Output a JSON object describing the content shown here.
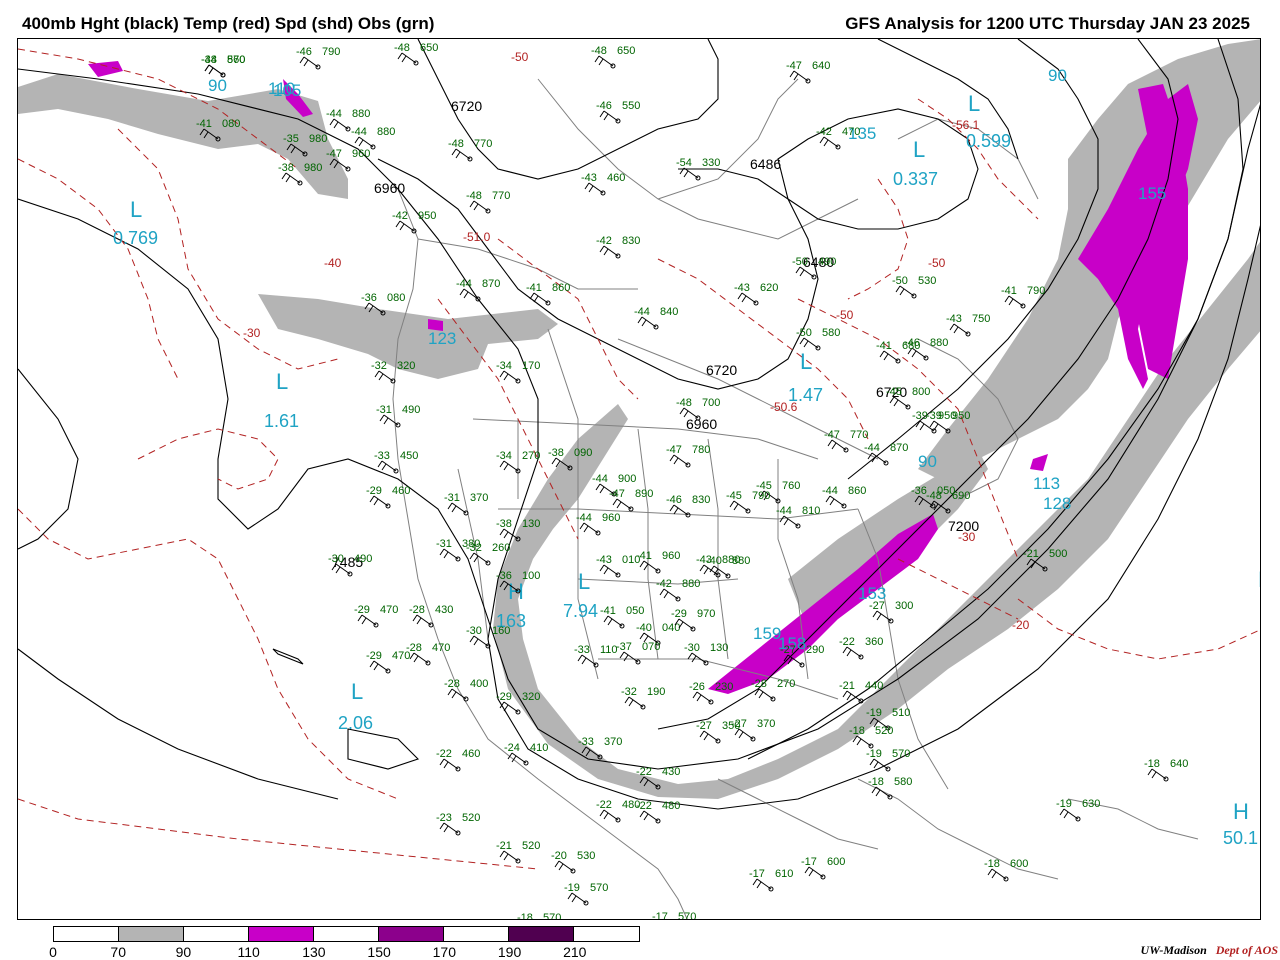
{
  "header": {
    "title_left": "400mb Hght (black) Temp (red) Spd (shd) Obs (grn)",
    "title_right": "GFS Analysis for 1200 UTC Thursday  JAN 23 2025"
  },
  "colors": {
    "height_contour": "#000000",
    "temp_contour": "#b22222",
    "map_outline": "#808080",
    "obs": "#006400",
    "center_label": "#1fa3c4",
    "speed_70_90": "#b4b4b4",
    "speed_110_130": "#c800c8",
    "speed_150_170": "#8c008c",
    "speed_190_210": "#500050"
  },
  "legend": {
    "ticks": [
      "0",
      "70",
      "90",
      "110",
      "130",
      "150",
      "170",
      "190",
      "210"
    ],
    "segments": [
      "#ffffff",
      "#b4b4b4",
      "#ffffff",
      "#c800c8",
      "#ffffff",
      "#8c008c",
      "#ffffff",
      "#500050",
      "#ffffff"
    ]
  },
  "credit": {
    "org": "UW-Madison",
    "dept": "Dept of AOS"
  },
  "map": {
    "height_labels": [
      "6720",
      "6960",
      "6486",
      "6480",
      "6720",
      "6720",
      "6960",
      "7200",
      "7485"
    ],
    "temp_labels": [
      "-50",
      "-51.0",
      "-40",
      "-30",
      "-50",
      "-56.1",
      "-50",
      "-50.6",
      "-30",
      "-20"
    ],
    "centers": [
      {
        "kind": "L",
        "value": "0.769"
      },
      {
        "kind": "L",
        "value": "1.61"
      },
      {
        "kind": "L",
        "value": "2.06"
      },
      {
        "kind": "L",
        "value": "7.94"
      },
      {
        "kind": "L",
        "value": "1.47"
      },
      {
        "kind": "L",
        "value": "0.337"
      },
      {
        "kind": "L",
        "value": "0.599"
      },
      {
        "kind": "H",
        "value": "163"
      },
      {
        "kind": "H",
        "value": "50.1"
      },
      {
        "kind": "H",
        "value": ""
      }
    ],
    "speed_labels": [
      "90",
      "110",
      "155",
      "90",
      "113",
      "128",
      "159",
      "158",
      "135",
      "153",
      "123",
      "90",
      "105"
    ],
    "observations": [
      {
        "t": "-34",
        "h": "870"
      },
      {
        "t": "-46",
        "h": "790"
      },
      {
        "t": "-48",
        "h": "650"
      },
      {
        "t": "-41",
        "h": "080"
      },
      {
        "t": "-44",
        "h": "880"
      },
      {
        "t": "-44",
        "h": "880"
      },
      {
        "t": "-47",
        "h": "960"
      },
      {
        "t": "-35",
        "h": "980"
      },
      {
        "t": "-38",
        "h": "980"
      },
      {
        "t": "-42",
        "h": "950"
      },
      {
        "t": "-48",
        "h": "770"
      },
      {
        "t": "-48",
        "h": "770"
      },
      {
        "t": "-43",
        "h": "460"
      },
      {
        "t": "-42",
        "h": "830"
      },
      {
        "t": "-48",
        "h": "650"
      },
      {
        "t": "-41",
        "h": "860"
      },
      {
        "t": "-44",
        "h": "840"
      },
      {
        "t": "-44",
        "h": "870"
      },
      {
        "t": "-36",
        "h": "080"
      },
      {
        "t": "-34",
        "h": "170"
      },
      {
        "t": "-32",
        "h": "320"
      },
      {
        "t": "-31",
        "h": "490"
      },
      {
        "t": "-33",
        "h": "450"
      },
      {
        "t": "-29",
        "h": "460"
      },
      {
        "t": "-31",
        "h": "370"
      },
      {
        "t": "-34",
        "h": "270"
      },
      {
        "t": "-38",
        "h": "090"
      },
      {
        "t": "-44",
        "h": "900"
      },
      {
        "t": "-47",
        "h": "890"
      },
      {
        "t": "-47",
        "h": "780"
      },
      {
        "t": "-48",
        "h": "700"
      },
      {
        "t": "-43",
        "h": "620"
      },
      {
        "t": "-50",
        "h": "580"
      },
      {
        "t": "-50",
        "h": "530"
      },
      {
        "t": "-50",
        "h": "490"
      },
      {
        "t": "-46",
        "h": "880"
      },
      {
        "t": "-43",
        "h": "750"
      },
      {
        "t": "-41",
        "h": "790"
      },
      {
        "t": "-45",
        "h": "800"
      },
      {
        "t": "-47",
        "h": "770"
      },
      {
        "t": "-39",
        "h": "950"
      },
      {
        "t": "-39",
        "h": "950"
      },
      {
        "t": "-36",
        "h": "050"
      },
      {
        "t": "-44",
        "h": "860"
      },
      {
        "t": "-44",
        "h": "810"
      },
      {
        "t": "-45",
        "h": "760"
      },
      {
        "t": "-45",
        "h": "790"
      },
      {
        "t": "-46",
        "h": "830"
      },
      {
        "t": "-44",
        "h": "960"
      },
      {
        "t": "-41",
        "h": "960"
      },
      {
        "t": "-43",
        "h": "010"
      },
      {
        "t": "-42",
        "h": "880"
      },
      {
        "t": "-43",
        "h": "880"
      },
      {
        "t": "-40",
        "h": "880"
      },
      {
        "t": "-38",
        "h": "130"
      },
      {
        "t": "-36",
        "h": "100"
      },
      {
        "t": "-29",
        "h": "470"
      },
      {
        "t": "-31",
        "h": "380"
      },
      {
        "t": "-32",
        "h": "260"
      },
      {
        "t": "-29",
        "h": "470"
      },
      {
        "t": "-28",
        "h": "430"
      },
      {
        "t": "-28",
        "h": "470"
      },
      {
        "t": "-30",
        "h": "160"
      },
      {
        "t": "-41",
        "h": "050"
      },
      {
        "t": "-40",
        "h": "040"
      },
      {
        "t": "-37",
        "h": "070"
      },
      {
        "t": "-33",
        "h": "110"
      },
      {
        "t": "-29",
        "h": "970"
      },
      {
        "t": "-30",
        "h": "130"
      },
      {
        "t": "-26",
        "h": "230"
      },
      {
        "t": "-28",
        "h": "270"
      },
      {
        "t": "-27",
        "h": "290"
      },
      {
        "t": "-22",
        "h": "360"
      },
      {
        "t": "-21",
        "h": "440"
      },
      {
        "t": "-27",
        "h": "300"
      },
      {
        "t": "-19",
        "h": "510"
      },
      {
        "t": "-18",
        "h": "520"
      },
      {
        "t": "-19",
        "h": "570"
      },
      {
        "t": "-18",
        "h": "580"
      },
      {
        "t": "-21",
        "h": "500"
      },
      {
        "t": "-28",
        "h": "400"
      },
      {
        "t": "-29",
        "h": "320"
      },
      {
        "t": "-33",
        "h": "370"
      },
      {
        "t": "-32",
        "h": "190"
      },
      {
        "t": "-27",
        "h": "350"
      },
      {
        "t": "-27",
        "h": "370"
      },
      {
        "t": "-22",
        "h": "430"
      },
      {
        "t": "-22",
        "h": "480"
      },
      {
        "t": "-22",
        "h": "480"
      },
      {
        "t": "-24",
        "h": "410"
      },
      {
        "t": "-22",
        "h": "460"
      },
      {
        "t": "-23",
        "h": "520"
      },
      {
        "t": "-21",
        "h": "520"
      },
      {
        "t": "-20",
        "h": "530"
      },
      {
        "t": "-19",
        "h": "570"
      },
      {
        "t": "-18",
        "h": "570"
      },
      {
        "t": "-17",
        "h": "610"
      },
      {
        "t": "-17",
        "h": "600"
      },
      {
        "t": "-17",
        "h": "570"
      },
      {
        "t": "-18",
        "h": "600"
      },
      {
        "t": "-19",
        "h": "630"
      },
      {
        "t": "-18",
        "h": "640"
      },
      {
        "t": "-30",
        "h": "490"
      },
      {
        "t": "-41",
        "h": "680"
      },
      {
        "t": "-44",
        "h": "870"
      },
      {
        "t": "-48",
        "h": "690"
      },
      {
        "t": "-47",
        "h": "640"
      },
      {
        "t": "-42",
        "h": "470"
      },
      {
        "t": "-54",
        "h": "330"
      },
      {
        "t": "-46",
        "h": "550"
      },
      {
        "t": "-48",
        "h": "560"
      }
    ]
  }
}
